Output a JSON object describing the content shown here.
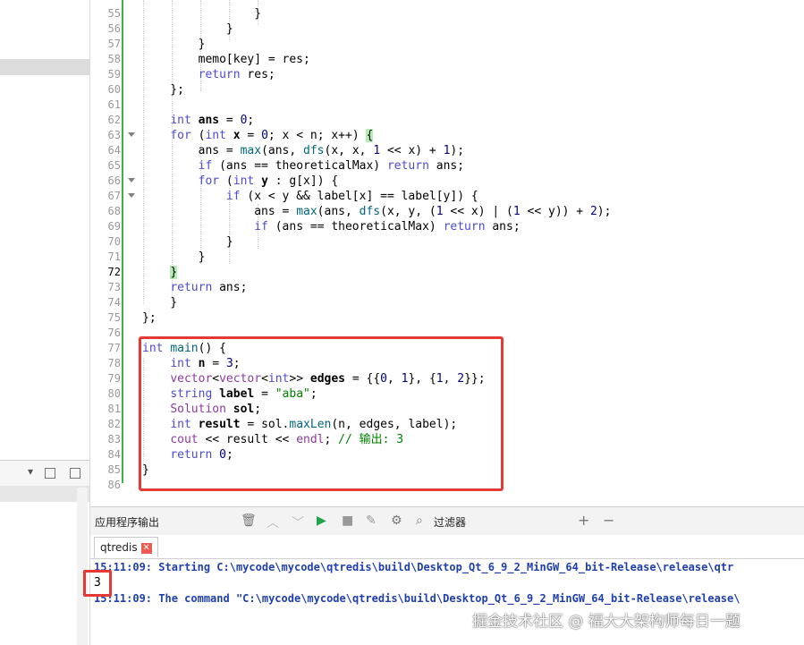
{
  "sidebar": {
    "toolbar_dropdown": "▾",
    "toolbar_icons": [
      "add-split-icon",
      "collapse-icon"
    ]
  },
  "editor": {
    "current_line": "72",
    "lines": [
      {
        "n": "55",
        "code": "                }"
      },
      {
        "n": "56",
        "code": "            }"
      },
      {
        "n": "57",
        "code": "        }"
      },
      {
        "n": "58",
        "code": "        memo[key] = res;"
      },
      {
        "n": "59",
        "code": "        return res;"
      },
      {
        "n": "60",
        "code": "    };"
      },
      {
        "n": "61",
        "code": ""
      },
      {
        "n": "62",
        "code": "    int ans = 0;"
      },
      {
        "n": "63",
        "code": "    for (int x = 0; x < n; x++) {"
      },
      {
        "n": "64",
        "code": "        ans = max(ans, dfs(x, x, 1 << x) + 1);"
      },
      {
        "n": "65",
        "code": "        if (ans == theoreticalMax) return ans;"
      },
      {
        "n": "66",
        "code": "        for (int y : g[x]) {"
      },
      {
        "n": "67",
        "code": "            if (x < y && label[x] == label[y]) {"
      },
      {
        "n": "68",
        "code": "                ans = max(ans, dfs(x, y, (1 << x) | (1 << y)) + 2);"
      },
      {
        "n": "69",
        "code": "                if (ans == theoreticalMax) return ans;"
      },
      {
        "n": "70",
        "code": "            }"
      },
      {
        "n": "71",
        "code": "        }"
      },
      {
        "n": "72",
        "code": "    }"
      },
      {
        "n": "73",
        "code": "    return ans;"
      },
      {
        "n": "74",
        "code": "    }"
      },
      {
        "n": "75",
        "code": "};"
      },
      {
        "n": "76",
        "code": ""
      },
      {
        "n": "77",
        "code": "int main() {"
      },
      {
        "n": "78",
        "code": "    int n = 3;"
      },
      {
        "n": "79",
        "code": "    vector<vector<int>> edges = {{0, 1}, {1, 2}};"
      },
      {
        "n": "80",
        "code": "    string label = \"aba\";"
      },
      {
        "n": "81",
        "code": "    Solution sol;"
      },
      {
        "n": "82",
        "code": "    int result = sol.maxLen(n, edges, label);"
      },
      {
        "n": "83",
        "code": "    cout << result << endl; // 输出: 3"
      },
      {
        "n": "84",
        "code": "    return 0;"
      },
      {
        "n": "85",
        "code": "}"
      },
      {
        "n": "86",
        "code": ""
      }
    ]
  },
  "output": {
    "title": "应用程序输出",
    "filter_label": "过滤器",
    "tab_label": "qtredis",
    "tab_close": "✕",
    "lines": [
      "15:11:09: Starting C:\\mycode\\mycode\\qtredis\\build\\Desktop_Qt_6_9_2_MinGW_64_bit-Release\\release\\qtr",
      "3",
      "15:11:09: The command \"C:\\mycode\\mycode\\qtredis\\build\\Desktop_Qt_6_9_2_MinGW_64_bit-Release\\release\\"
    ]
  },
  "watermark": "掘金技术社区 @ 福大大架构师每日一题",
  "colors": {
    "keyword": "#4b4bd6",
    "highlight_box": "#e53935",
    "modified_bar": "#3fb043",
    "output_blue": "#1f3fae"
  }
}
